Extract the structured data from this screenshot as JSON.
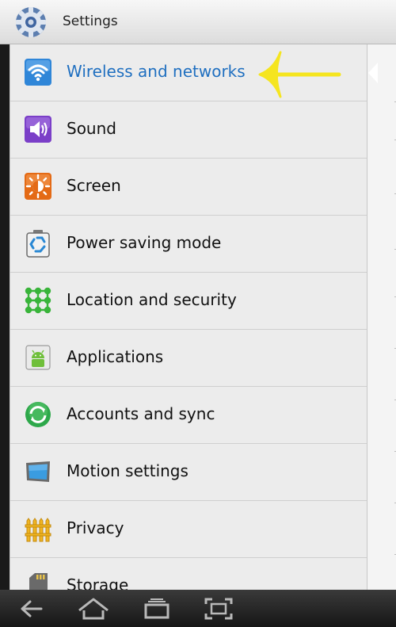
{
  "header": {
    "title": "Settings",
    "icon": "settings-gear-icon"
  },
  "settings_list": [
    {
      "label": "Wireless and networks",
      "icon": "wifi-icon",
      "selected": true
    },
    {
      "label": "Sound",
      "icon": "speaker-icon",
      "selected": false
    },
    {
      "label": "Screen",
      "icon": "brightness-icon",
      "selected": false
    },
    {
      "label": "Power saving mode",
      "icon": "recycle-battery-icon",
      "selected": false
    },
    {
      "label": "Location and security",
      "icon": "location-grid-icon",
      "selected": false
    },
    {
      "label": "Applications",
      "icon": "android-icon",
      "selected": false
    },
    {
      "label": "Accounts and sync",
      "icon": "sync-icon",
      "selected": false
    },
    {
      "label": "Motion settings",
      "icon": "tablet-motion-icon",
      "selected": false
    },
    {
      "label": "Privacy",
      "icon": "fence-icon",
      "selected": false
    },
    {
      "label": "Storage",
      "icon": "sd-card-icon",
      "selected": false
    }
  ],
  "annotation": {
    "type": "arrow",
    "color": "#f5e51f",
    "points_to": "Wireless and networks"
  },
  "navbar": {
    "buttons": [
      "back-icon",
      "home-icon",
      "recent-apps-icon",
      "screenshot-icon"
    ]
  },
  "colors": {
    "selected_text": "#1f6fc0",
    "list_background": "#ececec",
    "nav_background": "#222222"
  }
}
